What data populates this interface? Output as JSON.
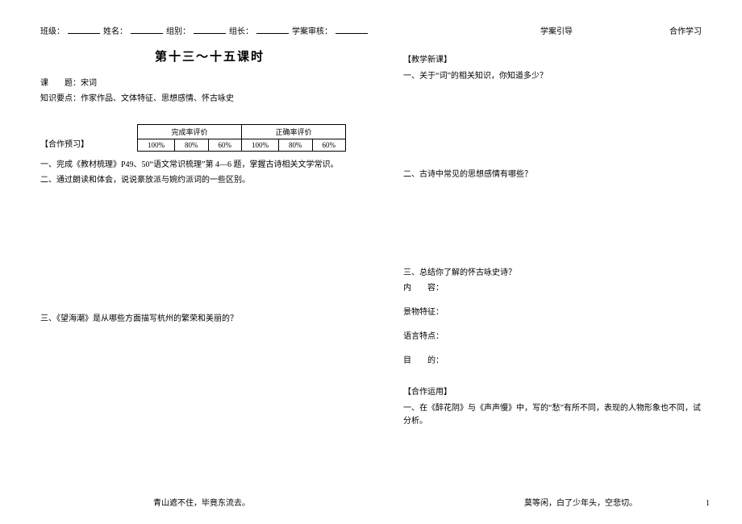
{
  "header": {
    "class_label": "班级：",
    "name_label": "姓名：",
    "group_label": "组别：",
    "leader_label": "组长：",
    "review_label": "学案审核："
  },
  "top_right": {
    "guide": "学案引导",
    "coop": "合作学习"
  },
  "left": {
    "title": "第十三～十五课时",
    "topic_label": "课　　题：",
    "topic_value": "宋词",
    "knowledge_label": "知识要点：",
    "knowledge_value": "作家作品、文体特征、思想感情、怀古咏史",
    "preview_head": "【合作预习】",
    "table": {
      "h1": "完成率评价",
      "h2": "正确率评价",
      "cols": [
        "100%",
        "80%",
        "60%",
        "100%",
        "80%",
        "60%"
      ]
    },
    "item1": "一、完成《教材梳理》P49、50“语文常识梳理”第 4—6 题，掌握古诗相关文学常识。",
    "item2": "二、通过朗读和体会，说说豪放派与婉约派词的一些区别。",
    "item3": "三、《望海潮》是从哪些方面描写杭州的繁荣和美丽的？"
  },
  "right": {
    "new_head": "【教学新课】",
    "q1": "一、关于“词”的相关知识，你知道多少？",
    "q2": "二、古诗中常见的思想感情有哪些？",
    "q3": "三、总结你了解的怀古咏史诗？",
    "content_label": "内　　容：",
    "scenery_label": "景物特征：",
    "lang_label": "语言特点：",
    "purpose_label": "目　　的：",
    "apply_head": "【合作运用】",
    "apply_q1": "一、在《醉花阴》与《声声慢》中，写的“愁”有所不同，表现的人物形象也不同，试分析。"
  },
  "footer": {
    "left_quote": "青山遮不住，毕竟东流去。",
    "right_quote": "莫等闲，白了少年头，空悲切。",
    "page": "1"
  }
}
